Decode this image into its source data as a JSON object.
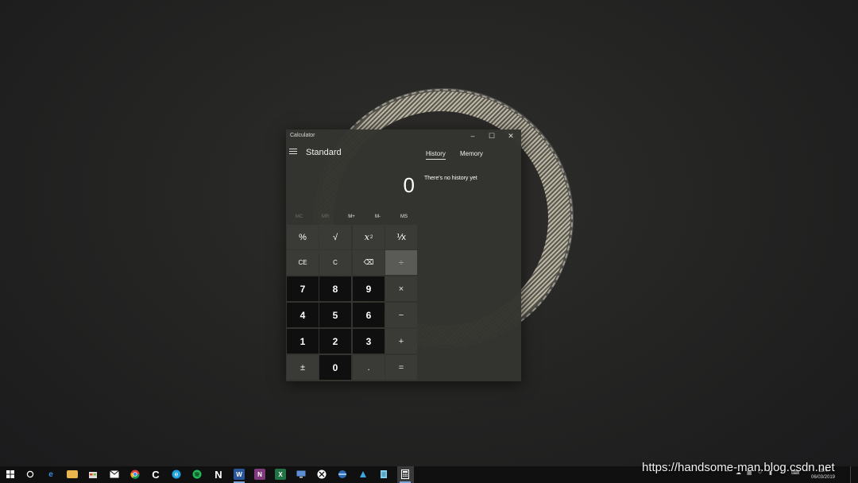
{
  "window": {
    "app_title": "Calculator",
    "minimize": "–",
    "maximize": "☐",
    "close": "✕"
  },
  "calculator": {
    "mode": "Standard",
    "display_value": "0",
    "memory_buttons": [
      {
        "label": "MC",
        "enabled": false
      },
      {
        "label": "MR",
        "enabled": false
      },
      {
        "label": "M+",
        "enabled": true
      },
      {
        "label": "M-",
        "enabled": true
      },
      {
        "label": "MS",
        "enabled": true
      }
    ],
    "keys": {
      "percent": "%",
      "sqrt": "√",
      "square_base": "x",
      "square_exp": "2",
      "reciprocal": "⅟x",
      "ce": "CE",
      "c": "C",
      "backspace": "⌫",
      "divide": "÷",
      "seven": "7",
      "eight": "8",
      "nine": "9",
      "multiply": "×",
      "four": "4",
      "five": "5",
      "six": "6",
      "minus": "−",
      "one": "1",
      "two": "2",
      "three": "3",
      "plus": "+",
      "negate": "±",
      "zero": "0",
      "decimal": ".",
      "equals": "="
    }
  },
  "history_panel": {
    "tabs": [
      "History",
      "Memory"
    ],
    "active_tab": "History",
    "empty_message": "There's no history yet"
  },
  "taskbar": {
    "clock_time": "18:4",
    "clock_date": "06/03/2019"
  },
  "watermark": "https://handsome-man.blog.csdn.net",
  "colors": {
    "number_key": "#0f0f0f",
    "function_key": "#3a3a37",
    "highlighted_key": "#5a5a57",
    "taskbar": "#101010"
  }
}
